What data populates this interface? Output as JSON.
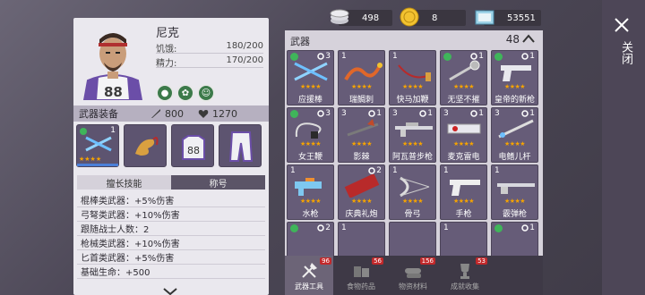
{
  "character": {
    "name": "尼克",
    "stats": [
      {
        "label": "饥饿:",
        "value": "180/200"
      },
      {
        "label": "精力:",
        "value": "170/200"
      }
    ],
    "jersey_number": "88"
  },
  "equipment": {
    "title": "武器装备",
    "attack": "800",
    "defense": "1270",
    "slot_weapon_count": "1"
  },
  "tabs": {
    "skills": "擅长技能",
    "title": "称号"
  },
  "skills": [
    "棍棒类武器：+5%伤害",
    "弓弩类武器：+10%伤害",
    "跟随战士人数：2",
    "枪械类武器：+10%伤害",
    "匕首类武器：+5%伤害",
    "基础生命：+500"
  ],
  "resources": {
    "silver": "498",
    "gold": "8",
    "tickets": "53551"
  },
  "inventory": {
    "title": "武器",
    "count": "48",
    "items": [
      {
        "name": "应援棒",
        "level": "",
        "count": "3",
        "recycle": true,
        "gear": true,
        "stars": 4,
        "art": "glowsticks"
      },
      {
        "name": "瑞鲷刺",
        "level": "1",
        "count": "",
        "recycle": false,
        "gear": false,
        "stars": 4,
        "art": "dragon"
      },
      {
        "name": "快马加鞭",
        "level": "1",
        "count": "",
        "recycle": false,
        "gear": false,
        "stars": 4,
        "art": "whip"
      },
      {
        "name": "无坚不摧",
        "level": "",
        "count": "1",
        "recycle": true,
        "gear": true,
        "stars": 4,
        "art": "mace"
      },
      {
        "name": "皇帝的新枪",
        "level": "",
        "count": "1",
        "recycle": true,
        "gear": true,
        "stars": 4,
        "art": "pistol"
      },
      {
        "name": "女王鞭",
        "level": "",
        "count": "3",
        "recycle": true,
        "gear": true,
        "stars": 4,
        "art": "queenwhip"
      },
      {
        "name": "影棘",
        "level": "3",
        "count": "1",
        "recycle": false,
        "gear": true,
        "stars": 4,
        "art": "thorn"
      },
      {
        "name": "阿瓦普步枪",
        "level": "3",
        "count": "1",
        "recycle": false,
        "gear": true,
        "stars": 4,
        "art": "rifle"
      },
      {
        "name": "麦克雷电",
        "level": "3",
        "count": "1",
        "recycle": false,
        "gear": true,
        "stars": 4,
        "art": "cannon"
      },
      {
        "name": "电鳍儿杆",
        "level": "3",
        "count": "1",
        "recycle": false,
        "gear": true,
        "stars": 4,
        "art": "rod"
      },
      {
        "name": "水枪",
        "level": "1",
        "count": "",
        "recycle": false,
        "gear": false,
        "stars": 4,
        "art": "watergun"
      },
      {
        "name": "庆典礼炮",
        "level": "",
        "count": "2",
        "recycle": false,
        "gear": true,
        "stars": 4,
        "art": "firework"
      },
      {
        "name": "骨弓",
        "level": "1",
        "count": "",
        "recycle": false,
        "gear": false,
        "stars": 4,
        "art": "bow"
      },
      {
        "name": "手枪",
        "level": "1",
        "count": "",
        "recycle": false,
        "gear": false,
        "stars": 4,
        "art": "handgun"
      },
      {
        "name": "霰弹枪",
        "level": "1",
        "count": "",
        "recycle": false,
        "gear": false,
        "stars": 4,
        "art": "shotgun"
      }
    ],
    "row4": [
      {
        "level": "",
        "count": "2",
        "recycle": true,
        "gear": true
      },
      {
        "level": "1",
        "count": "",
        "recycle": false,
        "gear": false
      },
      {
        "level": "",
        "count": "",
        "recycle": false,
        "gear": false
      },
      {
        "level": "1",
        "count": "",
        "recycle": false,
        "gear": false
      },
      {
        "level": "",
        "count": "1",
        "recycle": true,
        "gear": true
      }
    ]
  },
  "categories": [
    {
      "label": "武器工具",
      "badge": "96",
      "active": true
    },
    {
      "label": "食物药品",
      "badge": "56",
      "active": false
    },
    {
      "label": "物资材料",
      "badge": "156",
      "active": false
    },
    {
      "label": "成就收集",
      "badge": "53",
      "active": false
    }
  ],
  "close_label": "关闭"
}
